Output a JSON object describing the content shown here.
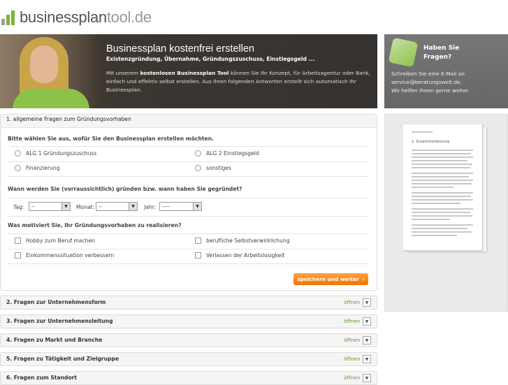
{
  "logo": {
    "part1": "businessplan",
    "part2": "tool.de"
  },
  "hero": {
    "title": "Businessplan kostenfrei erstellen",
    "subtitle": "Existenzgründung, Übernahme, Gründungszuschuss, Einstiegsgeld ...",
    "text_before": "Mit unserem ",
    "text_bold": "kostenlosen Businessplan Tool",
    "text_after": " können Sie Ihr Konzept, für Arbeitsagentur oder Bank, einfach und effektiv selbst erstellen. Aus Ihren folgenden Antworten erstellt sich automatisch Ihr Businessplan."
  },
  "sidebar": {
    "title_line1": "Haben Sie",
    "title_line2": "Fragen?",
    "text_line1": "Schreiben Sie eine E-Mail an",
    "text_line2": "service@beratungswelt.de.",
    "text_line3": "Wir helfen Ihnen gerne weiter."
  },
  "section1": {
    "header": "1. allgemeine Fragen zum Gründungsvorhaben",
    "q1": "Bitte wählen Sie aus, wofür Sie den Businessplan erstellen möchten.",
    "options": [
      "ALG 1 Gründungszuschuss",
      "ALG 2 Einstiegsgeld",
      "Finanzierung",
      "sonstiges"
    ],
    "q2": "Wann werden Sie (vorraussichtlich) gründen bzw. wann haben Sie gegründet?",
    "day_label": "Tag:",
    "day_value": "--",
    "month_label": "Monat:",
    "month_value": "--",
    "year_label": "Jahr:",
    "year_value": "----",
    "q3": "Was motiviert Sie, Ihr Gründungsvorhaben zu realisieren?",
    "motives": [
      "Hobby zum Beruf machen",
      "berufliche Selbstverwirklichung",
      "Einkommenssituation verbessern",
      "Verlassen der Arbeitslosigkeit"
    ],
    "save_button": "speichern und weiter"
  },
  "accordion": [
    {
      "title": "2. Fragen zur Unternehmensform",
      "open": "öffnen"
    },
    {
      "title": "3. Fragen zur Unternehmensleitung",
      "open": "öffnen"
    },
    {
      "title": "4. Fragen zu Markt und Branche",
      "open": "öffnen"
    },
    {
      "title": "5. Fragen zu Tätigkeit und Zielgruppe",
      "open": "öffnen"
    },
    {
      "title": "6. Fragen zum Standort",
      "open": "öffnen"
    }
  ],
  "preview": {
    "heading": "1. Zusammenfassung"
  },
  "colors": {
    "accent_green": "#8bc34a",
    "button_orange": "#f07400",
    "open_green": "#5aa02c"
  }
}
